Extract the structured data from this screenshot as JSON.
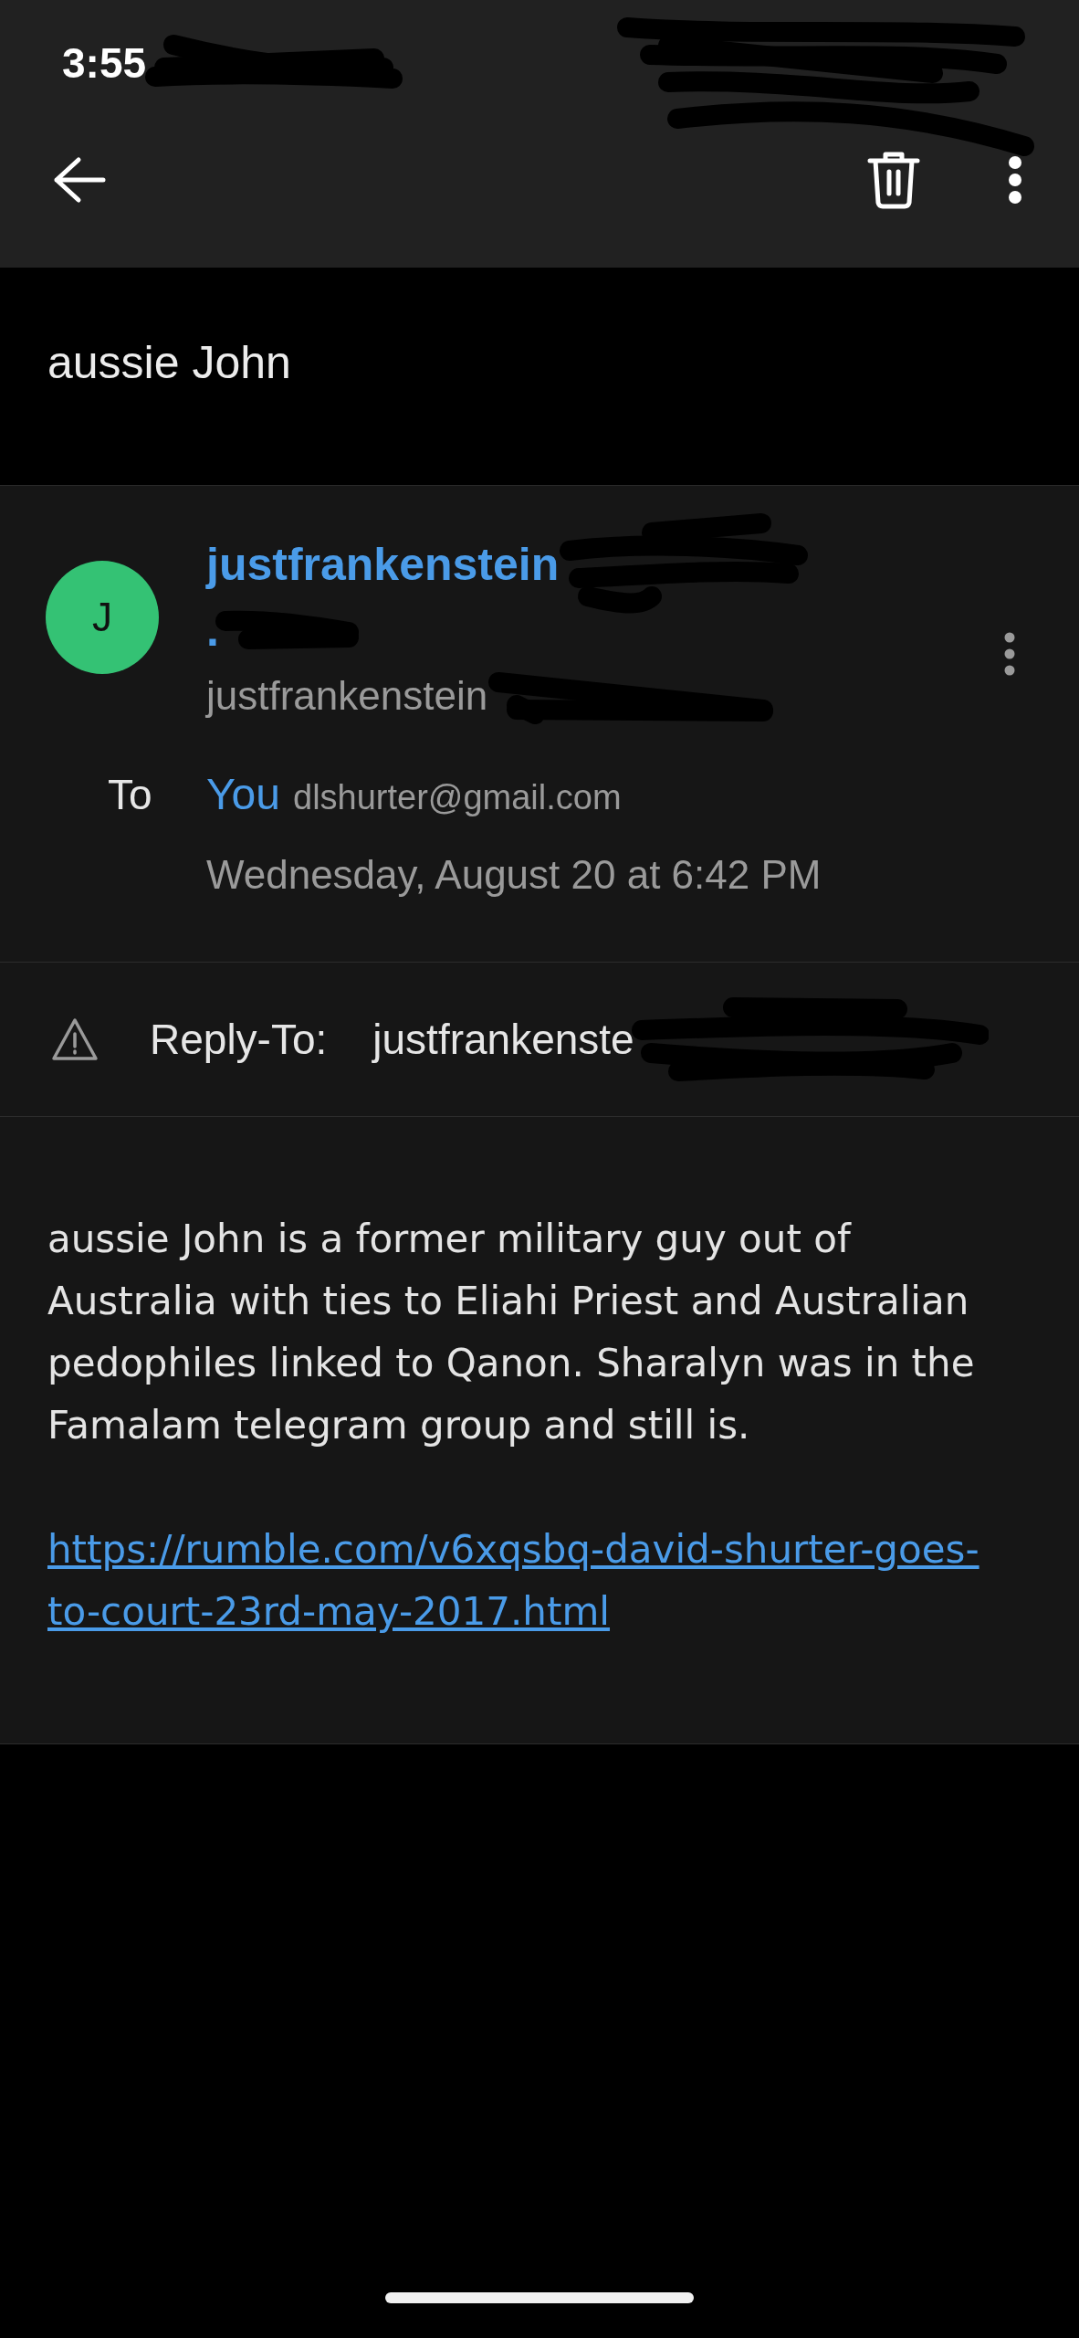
{
  "status_bar": {
    "time": "3:55"
  },
  "subject": "aussie John",
  "sender": {
    "initial": "J",
    "color": "#34c274",
    "name_lines": [
      "justfrankenstein",
      "."
    ],
    "address": "justfrankenstein"
  },
  "recipient": {
    "label": "To",
    "name": "You",
    "address": "dlshurter@gmail.com"
  },
  "date": "Wednesday, August 20 at 6:42 PM",
  "reply_to": {
    "label": "Reply-To:",
    "address": "justfrankenste"
  },
  "body": {
    "paragraphs": [
      {
        "kind": "text",
        "text": "aussie John is a former military guy out of Australia with ties to Eliahi Priest and Australian pedophiles linked to Qanon. Sharalyn was in the Famalam telegram group and still is."
      },
      {
        "kind": "link",
        "text": "https://rumble.com/v6xqsbq-david-shurter-goes-to-court-23rd-may-2017.html"
      }
    ]
  }
}
